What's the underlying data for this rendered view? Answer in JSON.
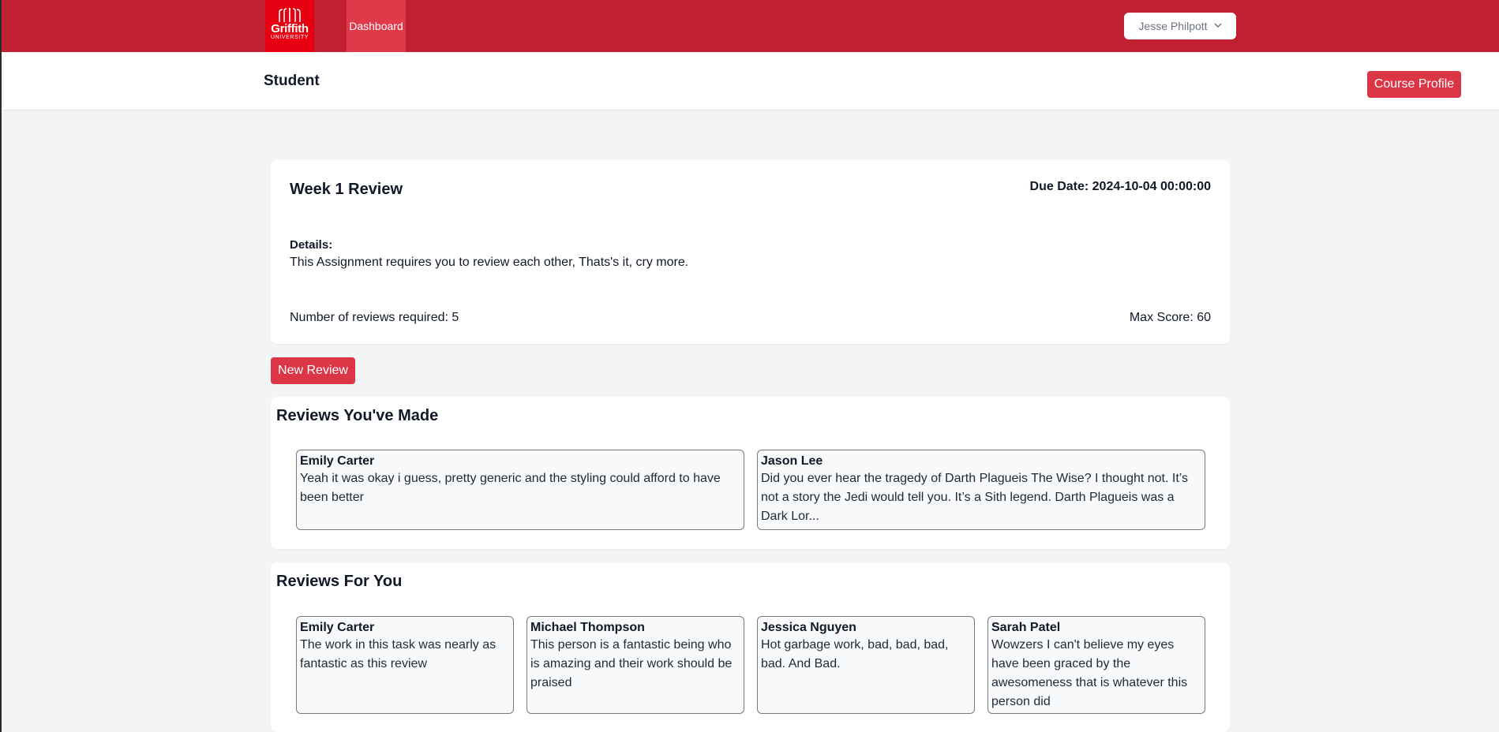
{
  "nav": {
    "logo": {
      "name": "Griffith",
      "sub": "UNIVERSITY"
    },
    "dashboard_tab": "Dashboard",
    "user_menu": {
      "name": "Jesse Philpott",
      "icon": "chevron-down-icon"
    }
  },
  "subheader": {
    "title": "Student",
    "course_profile_button": "Course Profile"
  },
  "assignment": {
    "title": "Week 1 Review",
    "due_date": "Due Date: 2024-10-04 00:00:00",
    "details_label": "Details:",
    "details_text": "This Assignment requires you to review each other, Thats's it, cry more.",
    "reviews_required": "Number of reviews required: 5",
    "max_score": "Max Score: 60"
  },
  "new_review_button": "New Review",
  "reviews_made": {
    "title": "Reviews You've Made",
    "items": [
      {
        "author": "Emily Carter",
        "text": "Yeah it was okay i guess, pretty generic and the styling could afford to have been better"
      },
      {
        "author": "Jason Lee",
        "text": "Did you ever hear the tragedy of Darth Plagueis The Wise? I thought not. It’s not a story the Jedi would tell you. It’s a Sith legend. Darth Plagueis was a Dark Lor..."
      }
    ]
  },
  "reviews_for_you": {
    "title": "Reviews For You",
    "items": [
      {
        "author": "Emily Carter",
        "text": "The work in this task was nearly as fantastic as this review"
      },
      {
        "author": "Michael Thompson",
        "text": "This person is a fantastic being who is amazing and their work should be praised"
      },
      {
        "author": "Jessica Nguyen",
        "text": "Hot garbage work, bad, bad, bad, bad. And Bad."
      },
      {
        "author": "Sarah Patel",
        "text": "Wowzers I can't believe my eyes have been graced by the awesomeness that is whatever this person did"
      }
    ]
  },
  "colors": {
    "nav_bg": "#c0202f",
    "logo_bg": "#e60012",
    "active_tab": "#e0394a",
    "accent_button": "#dc3545",
    "page_bg": "#f3f4f6"
  }
}
